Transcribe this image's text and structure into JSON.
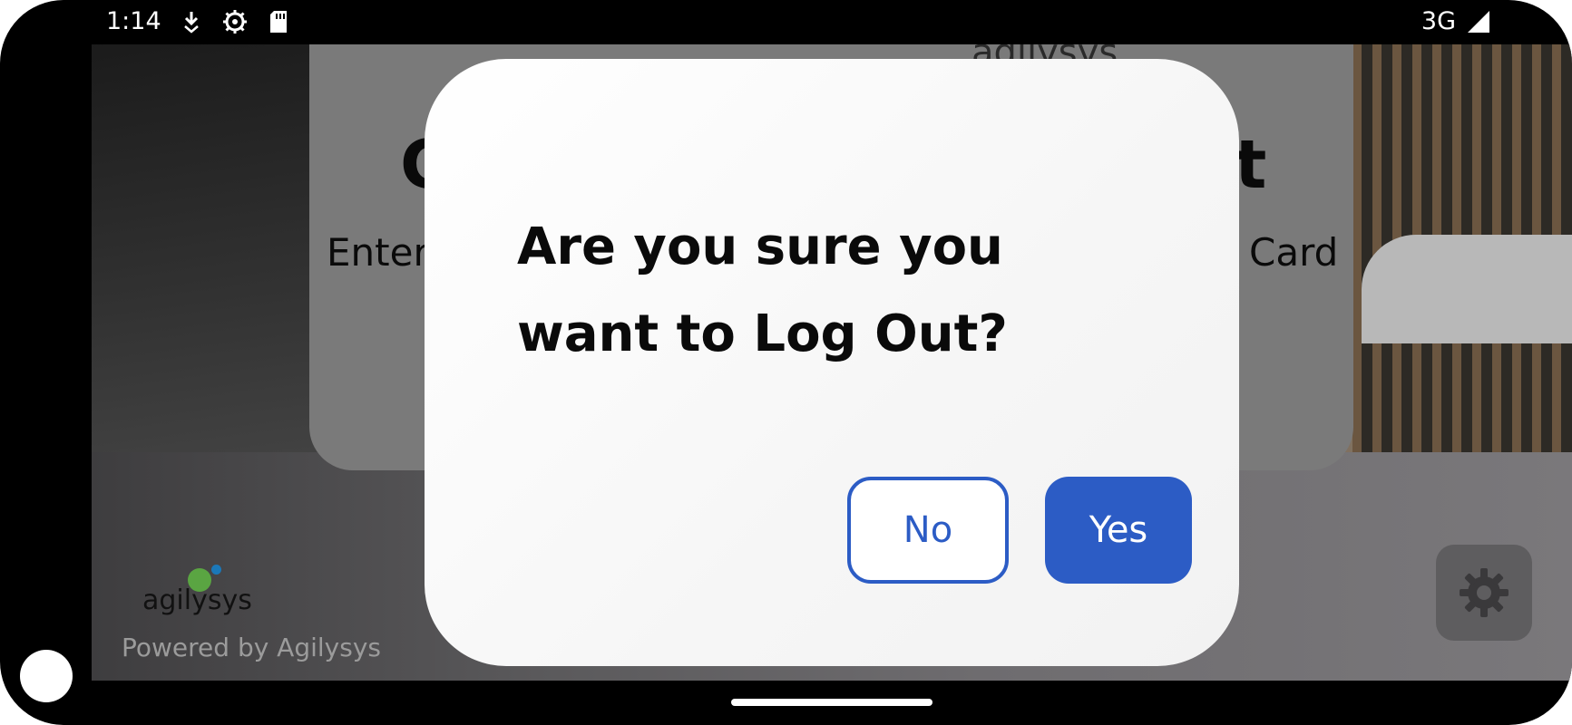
{
  "status_bar": {
    "time": "1:14",
    "icons_left": [
      "download-icon",
      "settings-gear-icon",
      "sd-card-icon"
    ],
    "network": "3G",
    "signal_icon": "signal-icon"
  },
  "background": {
    "card": {
      "logo_text": "agilysys",
      "heading_left": "C",
      "heading_right": "t",
      "subtitle_left": "Enter",
      "subtitle_right": "Card"
    },
    "footer": {
      "logo_text": "agilysys",
      "powered_by": "Powered by Agilysys"
    }
  },
  "dialog": {
    "message": "Are you sure you want to Log Out?",
    "no_label": "No",
    "yes_label": "Yes"
  },
  "colors": {
    "primary": "#2c5cc5",
    "dialog_bg": "#f7f7f7",
    "logo_green": "#5aa542",
    "logo_blue": "#1b78b8"
  }
}
